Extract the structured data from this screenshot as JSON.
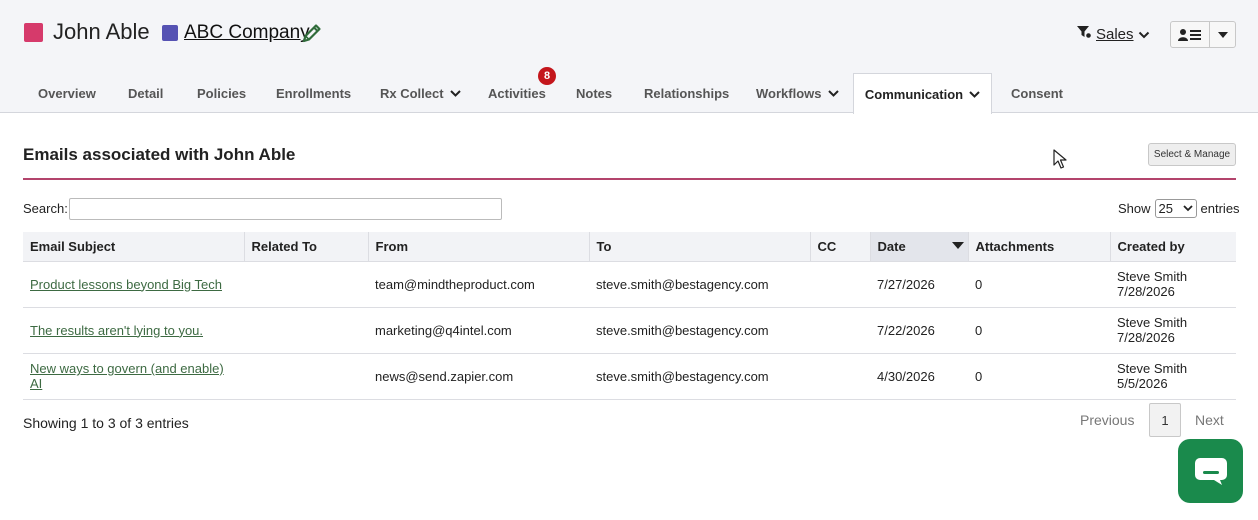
{
  "header": {
    "person_name": "John Able",
    "person_color": "#d63a6b",
    "company_name": "ABC Company",
    "company_color": "#5552b3",
    "edit_icon": "pencil-icon",
    "filter_label": "Sales",
    "view_icon": "contact-list-icon"
  },
  "tabs": [
    {
      "label": "Overview"
    },
    {
      "label": "Detail"
    },
    {
      "label": "Policies"
    },
    {
      "label": "Enrollments"
    },
    {
      "label": "Rx Collect",
      "dropdown": true
    },
    {
      "label": "Activities",
      "badge": "8"
    },
    {
      "label": "Notes"
    },
    {
      "label": "Relationships"
    },
    {
      "label": "Workflows",
      "dropdown": true
    },
    {
      "label": "Communication",
      "dropdown": true,
      "active": true
    },
    {
      "label": "Consent"
    }
  ],
  "section": {
    "title": "Emails associated with John Able",
    "select_manage_label": "Select & Manage",
    "accent_color": "#b3446c"
  },
  "search": {
    "label": "Search:",
    "value": ""
  },
  "length": {
    "show_label": "Show",
    "value": "25",
    "entries_label": "entries"
  },
  "table": {
    "columns": [
      "Email Subject",
      "Related To",
      "From",
      "To",
      "CC",
      "Date",
      "Attachments",
      "Created by"
    ],
    "sorted_column": "Date",
    "rows": [
      {
        "subject": "Product lessons beyond Big Tech",
        "related": "",
        "from": "team@mindtheproduct.com",
        "to": "steve.smith@bestagency.com",
        "cc": "",
        "date": "7/27/2026",
        "attachments": "0",
        "created_by": "Steve Smith",
        "created_date": "7/28/2026"
      },
      {
        "subject": "The results aren't lying to you.",
        "related": "",
        "from": "marketing@q4intel.com",
        "to": "steve.smith@bestagency.com",
        "cc": "",
        "date": "7/22/2026",
        "attachments": "0",
        "created_by": "Steve Smith",
        "created_date": "7/28/2026"
      },
      {
        "subject": "New ways to govern (and enable) AI",
        "related": "",
        "from": "news@send.zapier.com",
        "to": "steve.smith@bestagency.com",
        "cc": "",
        "date": "4/30/2026",
        "attachments": "0",
        "created_by": "Steve Smith",
        "created_date": "5/5/2026"
      }
    ]
  },
  "footer": {
    "info": "Showing 1 to 3 of 3 entries",
    "previous_label": "Previous",
    "page": "1",
    "next_label": "Next"
  },
  "colors": {
    "link": "#3d6a42",
    "chat": "#1a8a4c"
  },
  "chat": {
    "icon": "chat-bubble-icon"
  }
}
